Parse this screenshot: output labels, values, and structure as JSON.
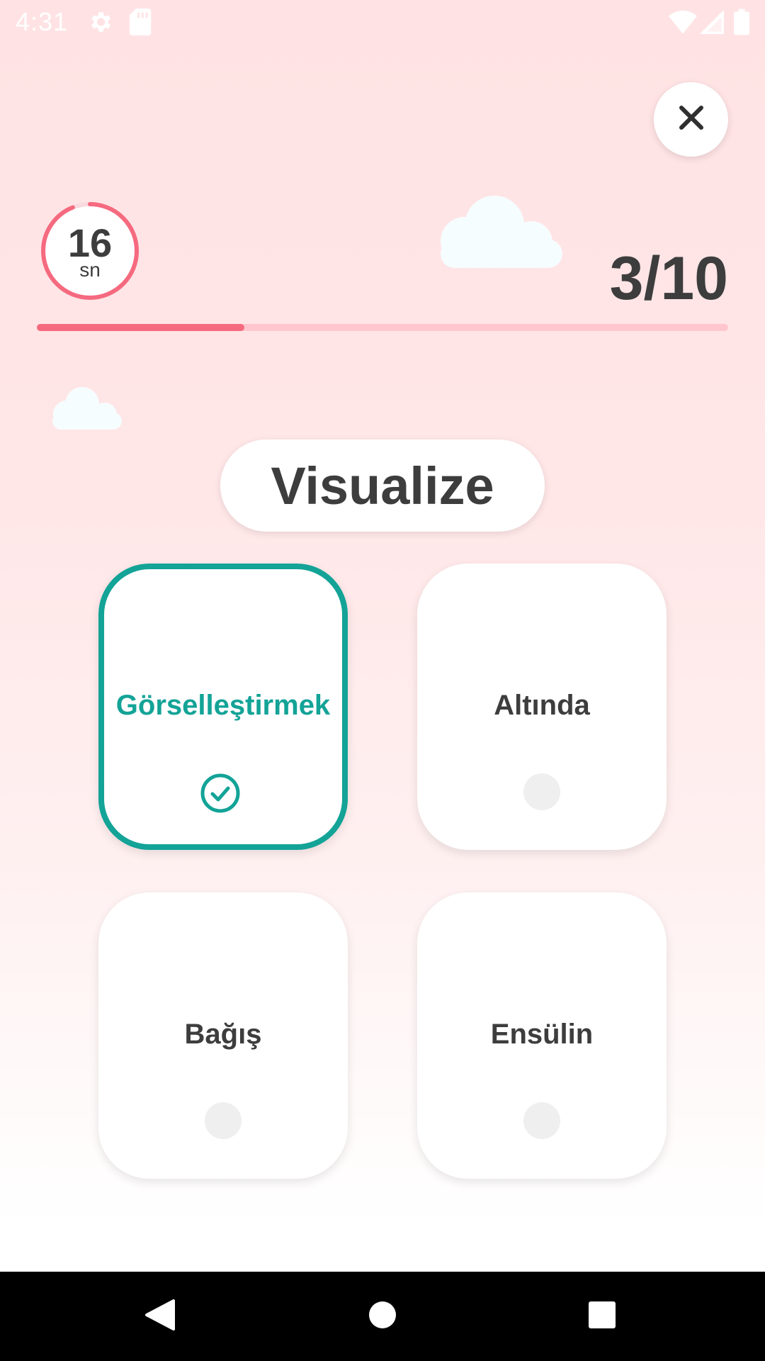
{
  "status_bar": {
    "time": "4:31",
    "icons": [
      "gear-icon",
      "sd-card-icon",
      "wifi-icon",
      "signal-icon",
      "battery-icon"
    ]
  },
  "header": {
    "close_icon": "close-icon",
    "timer": {
      "value": "16",
      "unit": "sn",
      "remaining_fraction": 0.94,
      "color": "#f56a7f"
    },
    "counter": "3/10",
    "progress": {
      "current": 3,
      "total": 10,
      "fraction": 0.3
    }
  },
  "question": {
    "word": "Visualize"
  },
  "options": [
    {
      "label": "Görselleştirmek",
      "selected": true
    },
    {
      "label": "Altında",
      "selected": false
    },
    {
      "label": "Bağış",
      "selected": false
    },
    {
      "label": "Ensülin",
      "selected": false
    }
  ],
  "colors": {
    "accent": "#13a397",
    "progress_fill": "#f56a7f",
    "progress_track": "#ffc6cf",
    "text": "#3d3d3d"
  },
  "nav_bar": {
    "icons": [
      "back-icon",
      "home-icon",
      "recents-icon"
    ]
  }
}
